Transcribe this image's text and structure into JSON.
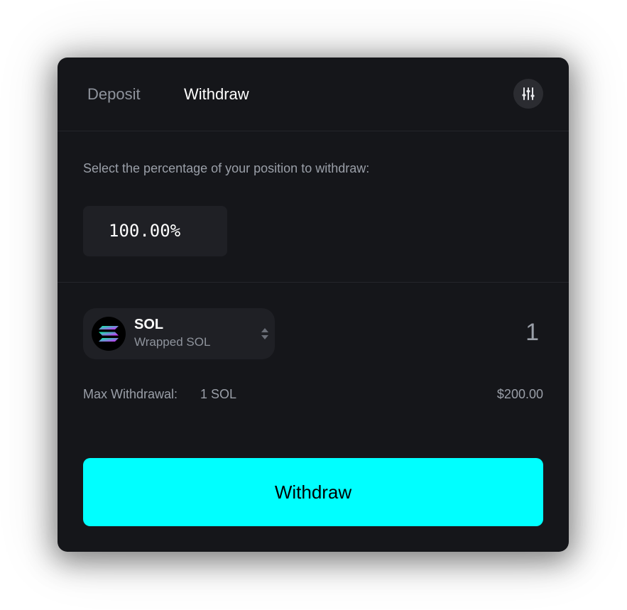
{
  "tabs": {
    "deposit_label": "Deposit",
    "withdraw_label": "Withdraw",
    "active": "withdraw"
  },
  "settings": {
    "icon": "sliders-icon"
  },
  "withdraw_percentage": {
    "prompt": "Select the percentage of your position to withdraw:",
    "value": "100.00%"
  },
  "token": {
    "symbol": "SOL",
    "name": "Wrapped SOL",
    "logo_icon": "solana-logo",
    "selector_icon": "chevron-up-down-icon",
    "amount": "1"
  },
  "max_withdrawal": {
    "label": "Max Withdrawal:",
    "value": "1 SOL",
    "usd": "$200.00"
  },
  "action": {
    "withdraw_label": "Withdraw"
  },
  "colors": {
    "panel_bg": "#15161a",
    "input_bg": "#1f2025",
    "accent": "#00ffff",
    "text_primary": "#ffffff",
    "text_muted": "#9a9fa8"
  }
}
